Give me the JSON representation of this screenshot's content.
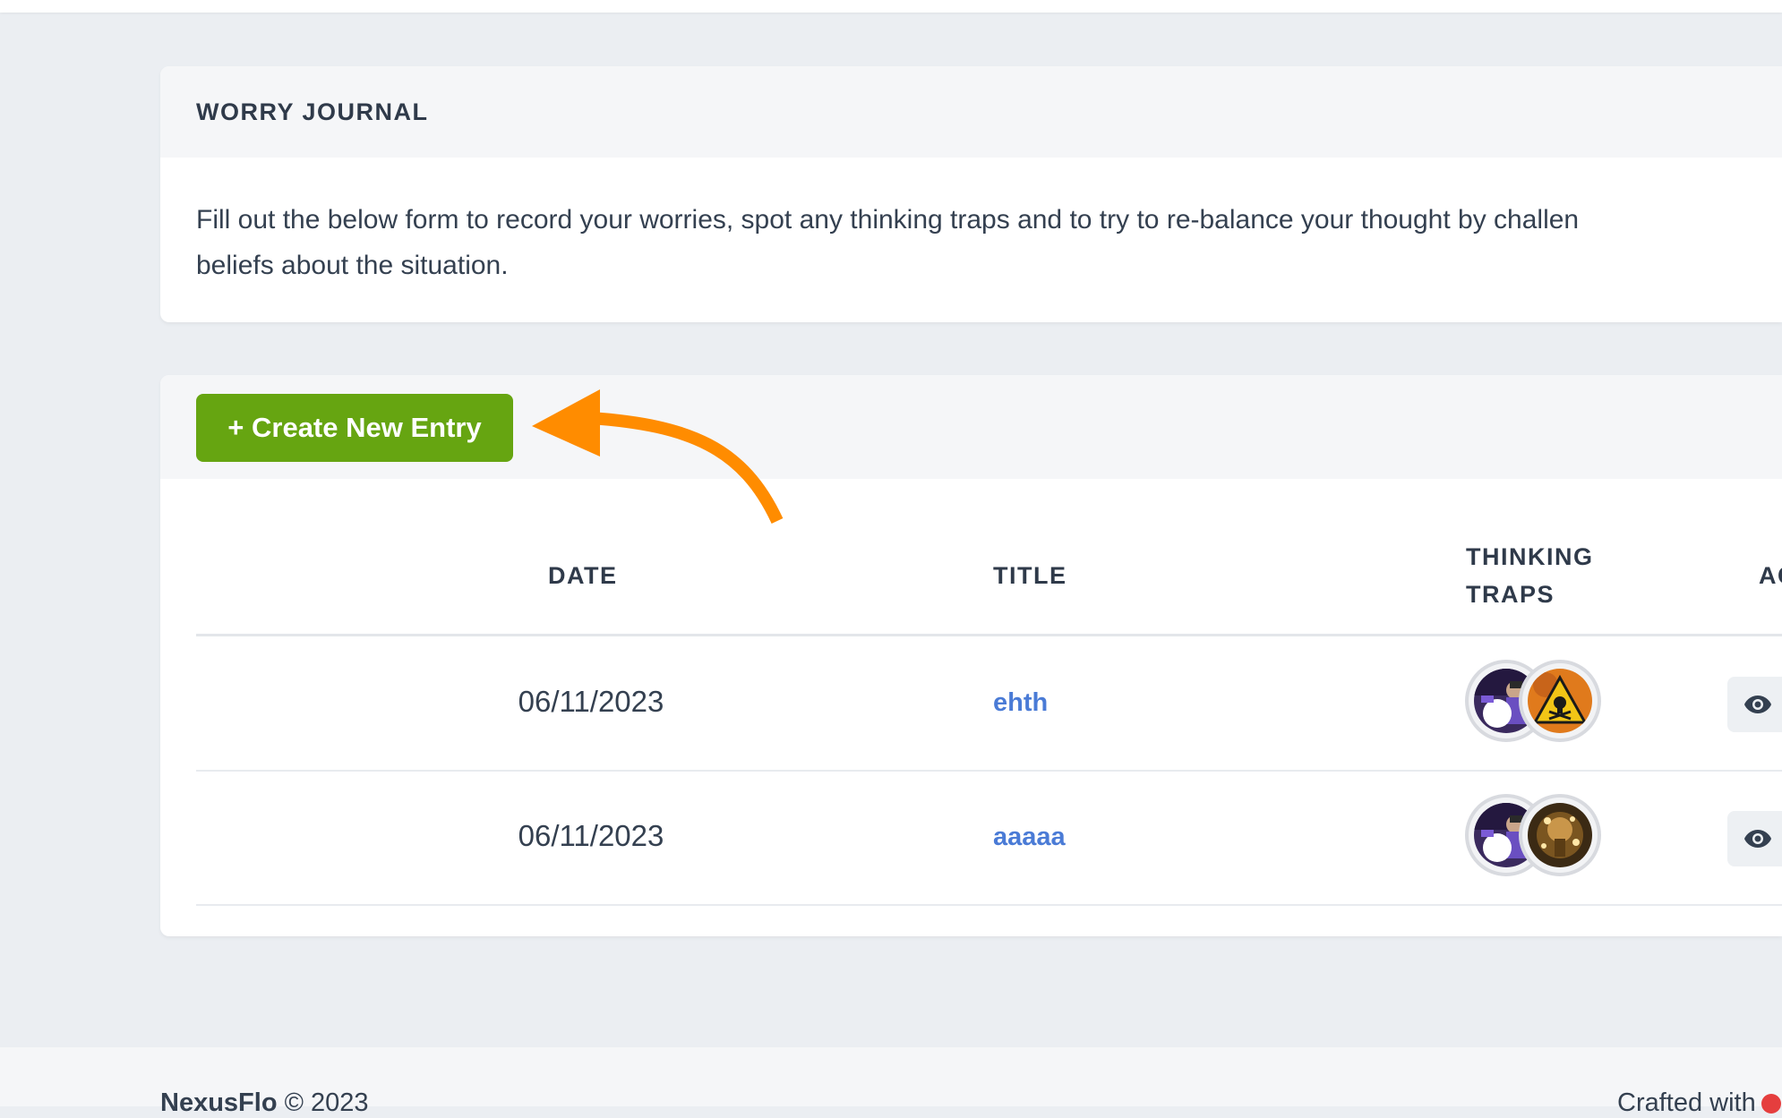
{
  "journal": {
    "title": "WORRY JOURNAL",
    "description_line1": "Fill out the below form to record your worries, spot any thinking traps and to try to re-balance your thought by challen",
    "description_line2": "beliefs about the situation."
  },
  "toolbar": {
    "create_label": "+ Create New Entry"
  },
  "table": {
    "headers": {
      "date": "DATE",
      "title": "TITLE",
      "traps_line1": "THINKING",
      "traps_line2": "TRAPS",
      "actions": "AC"
    },
    "rows": [
      {
        "date": "06/11/2023",
        "title": "ehth",
        "traps": [
          "person-thumbnail",
          "hazard-sign-thumbnail"
        ]
      },
      {
        "date": "06/11/2023",
        "title": "aaaaa",
        "traps": [
          "person-thumbnail",
          "sparkler-thumbnail"
        ]
      }
    ]
  },
  "footer": {
    "brand": "NexusFlo",
    "copyright": "© 2023",
    "crafted": "Crafted with"
  },
  "colors": {
    "accent_green": "#66a511",
    "link_blue": "#4a7bd6",
    "annotation_orange": "#ff8c00",
    "heart_red": "#e53e3e"
  },
  "icons": {
    "view": "eye-icon",
    "heart": "heart-icon"
  }
}
